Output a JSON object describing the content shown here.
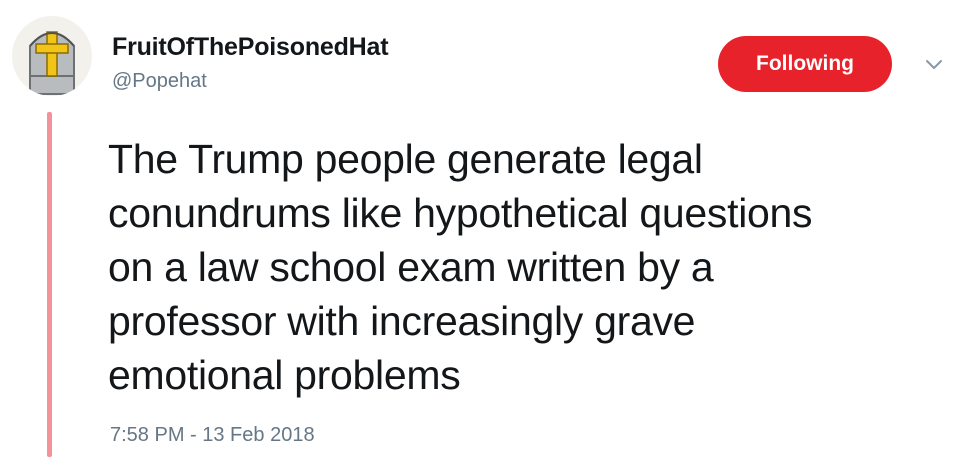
{
  "user": {
    "display_name": "FruitOfThePoisonedHat",
    "handle": "@Popehat"
  },
  "follow_button": {
    "label": "Following"
  },
  "tweet": {
    "lines": [
      "The Trump people generate legal",
      "conundrums like hypothetical questions",
      "on a law school exam written by a",
      "professor with increasingly grave",
      "emotional problems"
    ],
    "timestamp": "7:58 PM - 13 Feb 2018"
  },
  "icons": {
    "avatar": "popehat-mitre-icon",
    "menu": "chevron-down-icon"
  },
  "colors": {
    "follow_button_bg": "#e8222a",
    "thread_line": "#f4929a",
    "secondary_text": "#657786",
    "primary_text": "#14171a"
  }
}
